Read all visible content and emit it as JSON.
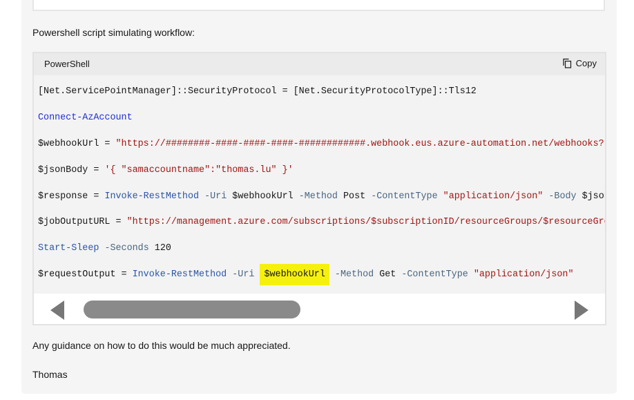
{
  "intro_text": "Powershell script simulating workflow:",
  "code": {
    "language": "PowerShell",
    "copy_label": "Copy",
    "lines": [
      {
        "parts": [
          {
            "t": "[Net.ServicePointManager]::SecurityProtocol = [Net.SecurityProtocolType]::Tls12",
            "c": ""
          }
        ]
      },
      {
        "parts": [
          {
            "t": "Connect-AzAccount",
            "c": "kw"
          }
        ]
      },
      {
        "parts": [
          {
            "t": "$webhookUrl = ",
            "c": ""
          },
          {
            "t": "\"https://########-####-####-####-############.webhook.eus.azure-automation.net/webhooks?token",
            "c": "str"
          }
        ]
      },
      {
        "parts": [
          {
            "t": "$jsonBody = ",
            "c": ""
          },
          {
            "t": "'{ \"samaccountname\":\"thomas.lu\" }'",
            "c": "str"
          }
        ]
      },
      {
        "parts": [
          {
            "t": "$response = ",
            "c": ""
          },
          {
            "t": "Invoke-RestMethod",
            "c": "cmd"
          },
          {
            "t": " ",
            "c": ""
          },
          {
            "t": "-Uri",
            "c": "param"
          },
          {
            "t": " $webhookUrl ",
            "c": ""
          },
          {
            "t": "-Method",
            "c": "param"
          },
          {
            "t": " Post ",
            "c": ""
          },
          {
            "t": "-ContentType",
            "c": "param"
          },
          {
            "t": " ",
            "c": ""
          },
          {
            "t": "\"application/json\"",
            "c": "str"
          },
          {
            "t": " ",
            "c": ""
          },
          {
            "t": "-Body",
            "c": "param"
          },
          {
            "t": " $jsonBody",
            "c": ""
          }
        ]
      },
      {
        "parts": [
          {
            "t": "$jobOutputURL = ",
            "c": ""
          },
          {
            "t": "\"https://management.azure.com/subscriptions/$subscriptionID/resourceGroups/$resourceGroup",
            "c": "str"
          },
          {
            "t": "}",
            "c": "str hl-pad"
          },
          {
            "t": "/",
            "c": "str"
          }
        ]
      },
      {
        "parts": [
          {
            "t": "Start-Sleep",
            "c": "cmd"
          },
          {
            "t": " ",
            "c": ""
          },
          {
            "t": "-Seconds",
            "c": "param"
          },
          {
            "t": " 120",
            "c": ""
          }
        ]
      },
      {
        "parts": [
          {
            "t": "$requestOutput = ",
            "c": ""
          },
          {
            "t": "Invoke-RestMethod",
            "c": "cmd"
          },
          {
            "t": " ",
            "c": ""
          },
          {
            "t": "-Uri",
            "c": "param"
          },
          {
            "t": " ",
            "c": ""
          },
          {
            "t": "$webhookUrl",
            "c": "hl-pad"
          },
          {
            "t": " ",
            "c": ""
          },
          {
            "t": "-Method",
            "c": "param"
          },
          {
            "t": " Get ",
            "c": ""
          },
          {
            "t": "-ContentType",
            "c": "param"
          },
          {
            "t": " ",
            "c": ""
          },
          {
            "t": "\"application/json\"",
            "c": "str"
          }
        ]
      }
    ]
  },
  "guidance_text": "Any guidance on how to do this would be much appreciated.",
  "signature": "Thomas",
  "colors": {
    "highlight": "#f6f00f",
    "keyword": "#1f2fd0",
    "string": "#a31515",
    "parameter": "#4a6580"
  }
}
